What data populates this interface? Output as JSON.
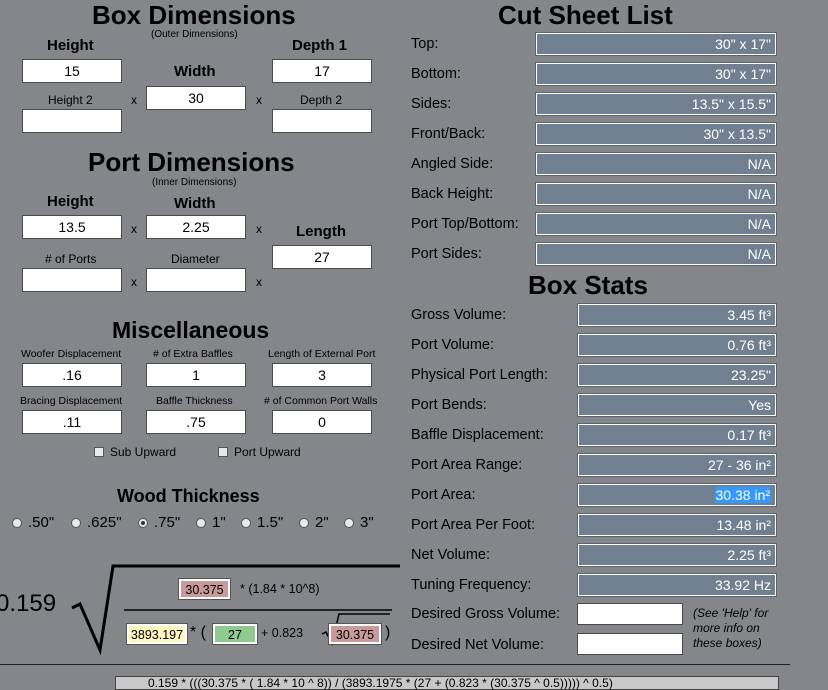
{
  "box_dimensions": {
    "title": "Box Dimensions",
    "subtitle": "(Outer Dimensions)",
    "height_label": "Height",
    "height_value": "15",
    "width_label": "Width",
    "width_value": "30",
    "depth1_label": "Depth 1",
    "depth1_value": "17",
    "height2_label": "Height 2",
    "height2_value": "",
    "depth2_label": "Depth 2",
    "depth2_value": "",
    "times": "x"
  },
  "port_dimensions": {
    "title": "Port Dimensions",
    "subtitle": "(Inner Dimensions)",
    "height_label": "Height",
    "height_value": "13.5",
    "width_label": "Width",
    "width_value": "2.25",
    "length_label": "Length",
    "length_value": "27",
    "ports_label": "# of Ports",
    "ports_value": "",
    "diameter_label": "Diameter",
    "diameter_value": ""
  },
  "misc": {
    "title": "Miscellaneous",
    "woofer_label": "Woofer Displacement",
    "woofer_value": ".16",
    "baffles_label": "# of Extra Baffles",
    "baffles_value": "1",
    "ext_port_label": "Length of External Port",
    "ext_port_value": "3",
    "bracing_label": "Bracing Displacement",
    "bracing_value": ".11",
    "baffle_thick_label": "Baffle Thickness",
    "baffle_thick_value": ".75",
    "common_walls_label": "# of Common Port Walls",
    "common_walls_value": "0",
    "sub_upward": "Sub Upward",
    "port_upward": "Port Upward"
  },
  "wood": {
    "title": "Wood Thickness",
    "options": [
      ".50\"",
      ".625\"",
      ".75\"",
      "1\"",
      "1.5\"",
      "2\"",
      "3\""
    ],
    "selected": ".75\""
  },
  "formula": {
    "coef": "0.159",
    "area1": "30.375",
    "mult_text": "* (1.84 * 10^8)",
    "net_val": "3893.197",
    "star_paren": "* (",
    "length_val": "27",
    "plus_text": "+ 0.823",
    "area2": "30.375",
    "close_paren": ")",
    "bottom_text": "0.159 * (((30.375 * ( 1.84 * 10 ^ 8)) / (3893.1975 * (27 + (0.823 * (30.375 ^ 0.5))))) ^ 0.5)"
  },
  "cut_sheet": {
    "title": "Cut Sheet List",
    "rows": [
      {
        "label": "Top:",
        "value": "30\" x 17\""
      },
      {
        "label": "Bottom:",
        "value": "30\" x 17\""
      },
      {
        "label": "Sides:",
        "value": "13.5\" x 15.5\""
      },
      {
        "label": "Front/Back:",
        "value": "30\" x 13.5\""
      },
      {
        "label": "Angled Side:",
        "value": "N/A"
      },
      {
        "label": "Back Height:",
        "value": "N/A"
      },
      {
        "label": "Port Top/Bottom:",
        "value": "N/A"
      },
      {
        "label": "Port Sides:",
        "value": "N/A"
      }
    ]
  },
  "box_stats": {
    "title": "Box Stats",
    "rows": [
      {
        "label": "Gross Volume:",
        "value": "3.45 ft³"
      },
      {
        "label": "Port Volume:",
        "value": "0.76 ft³"
      },
      {
        "label": "Physical Port Length:",
        "value": "23.25\""
      },
      {
        "label": "Port Bends:",
        "value": "Yes"
      },
      {
        "label": "Baffle Displacement:",
        "value": "0.17 ft³"
      },
      {
        "label": "Port Area Range:",
        "value": "27 - 36 in²"
      },
      {
        "label": "Port Area:",
        "value": "30.38 in²"
      },
      {
        "label": "Port Area Per Foot:",
        "value": "13.48 in²"
      },
      {
        "label": "Net Volume:",
        "value": "2.25 ft³"
      },
      {
        "label": "Tuning Frequency:",
        "value": "33.92 Hz"
      }
    ],
    "desired_gross_label": "Desired Gross Volume:",
    "desired_gross_value": "",
    "desired_net_label": "Desired Net Volume:",
    "desired_net_value": "",
    "help_note_1": "(See 'Help' for",
    "help_note_2": "more info on",
    "help_note_3": "these boxes)"
  },
  "colors": {
    "background": "#848689",
    "field_bg": "#708090",
    "selection": "#3399ff",
    "formula_red": "#c99a9a",
    "formula_yellow": "#fff5c0",
    "formula_green": "#8fcb8f"
  }
}
